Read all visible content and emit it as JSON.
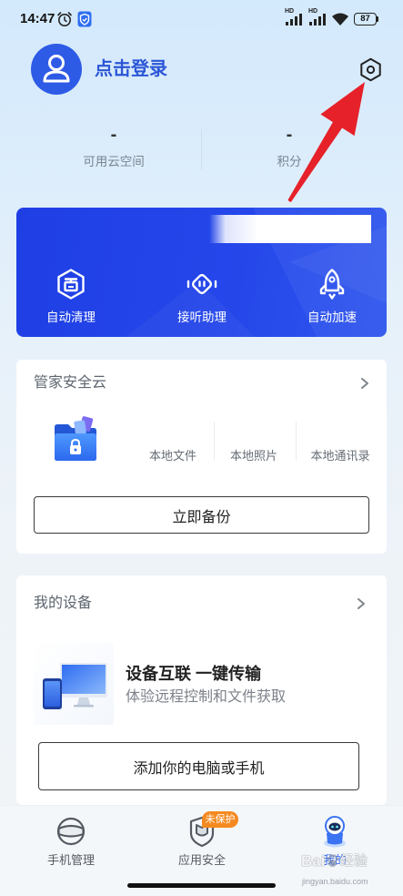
{
  "status_bar": {
    "time": "14:47",
    "network_1": "HD",
    "network_2": "HD",
    "battery": "87"
  },
  "header": {
    "login_text": "点击登录"
  },
  "stats": {
    "cloud_space": {
      "value": "-",
      "label": "可用云空间"
    },
    "points": {
      "value": "-",
      "label": "积分"
    }
  },
  "banner": {
    "items": [
      {
        "label": "自动清理",
        "icon": "auto-clean-icon"
      },
      {
        "label": "接听助理",
        "icon": "call-assistant-icon"
      },
      {
        "label": "自动加速",
        "icon": "rocket-icon"
      }
    ]
  },
  "cloud_card": {
    "title": "管家安全云",
    "items": [
      "本地文件",
      "本地照片",
      "本地通讯录"
    ],
    "button": "立即备份"
  },
  "device_card": {
    "title": "我的设备",
    "headline": "设备互联 一键传输",
    "subtitle": "体验远程控制和文件获取",
    "button": "添加你的电脑或手机"
  },
  "bottom_nav": {
    "items": [
      {
        "label": "手机管理",
        "icon": "phone-guard-icon"
      },
      {
        "label": "应用安全",
        "icon": "app-shield-icon",
        "badge": "未保护"
      },
      {
        "label": "我的",
        "icon": "mascot-icon",
        "active": true
      }
    ]
  },
  "watermark": {
    "brand": "Bai",
    "suffix": "经验",
    "site": "jingyan.baidu.com"
  },
  "colors": {
    "accent": "#2e5be6",
    "banner": "#2344e9",
    "badge": "#f5891f",
    "annotation_arrow": "#e62129"
  }
}
